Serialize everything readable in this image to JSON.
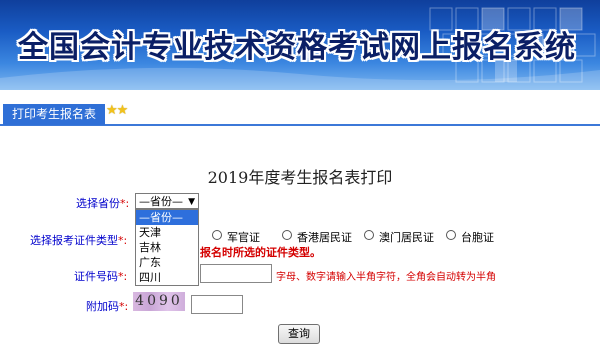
{
  "header": {
    "title": "全国会计专业技术资格考试网上报名系统"
  },
  "nav": {
    "tab_label": "打印考生报名表",
    "stars": "★★"
  },
  "form": {
    "title": "2019年度考生报名表打印",
    "province": {
      "label": "选择省份",
      "required_mark": "*:",
      "selected": "—省份—",
      "options": [
        "—省份—",
        "天津",
        "吉林",
        "广东",
        "四川"
      ],
      "highlighted_index": 0
    },
    "id_type": {
      "label": "选择报考证件类型",
      "required_mark": "*:",
      "options": [
        "军官证",
        "香港居民证",
        "澳门居民证",
        "台胞证"
      ],
      "warning": "报名时所选的证件类型。"
    },
    "id_number": {
      "label": "证件号码",
      "required_mark": "*:",
      "value": "",
      "hint": "字母、数字请输入半角字符，全角会自动转为半角"
    },
    "captcha": {
      "label": "附加码",
      "required_mark": "*:",
      "image_text": "4090",
      "value": ""
    },
    "submit_label": "查询"
  },
  "colors": {
    "banner_blue": "#1a5cc4",
    "nav_tab": "#2f6fd6",
    "label_blue": "#0000cc",
    "warning_red": "#d40000",
    "selection_blue": "#2e6fdc"
  }
}
